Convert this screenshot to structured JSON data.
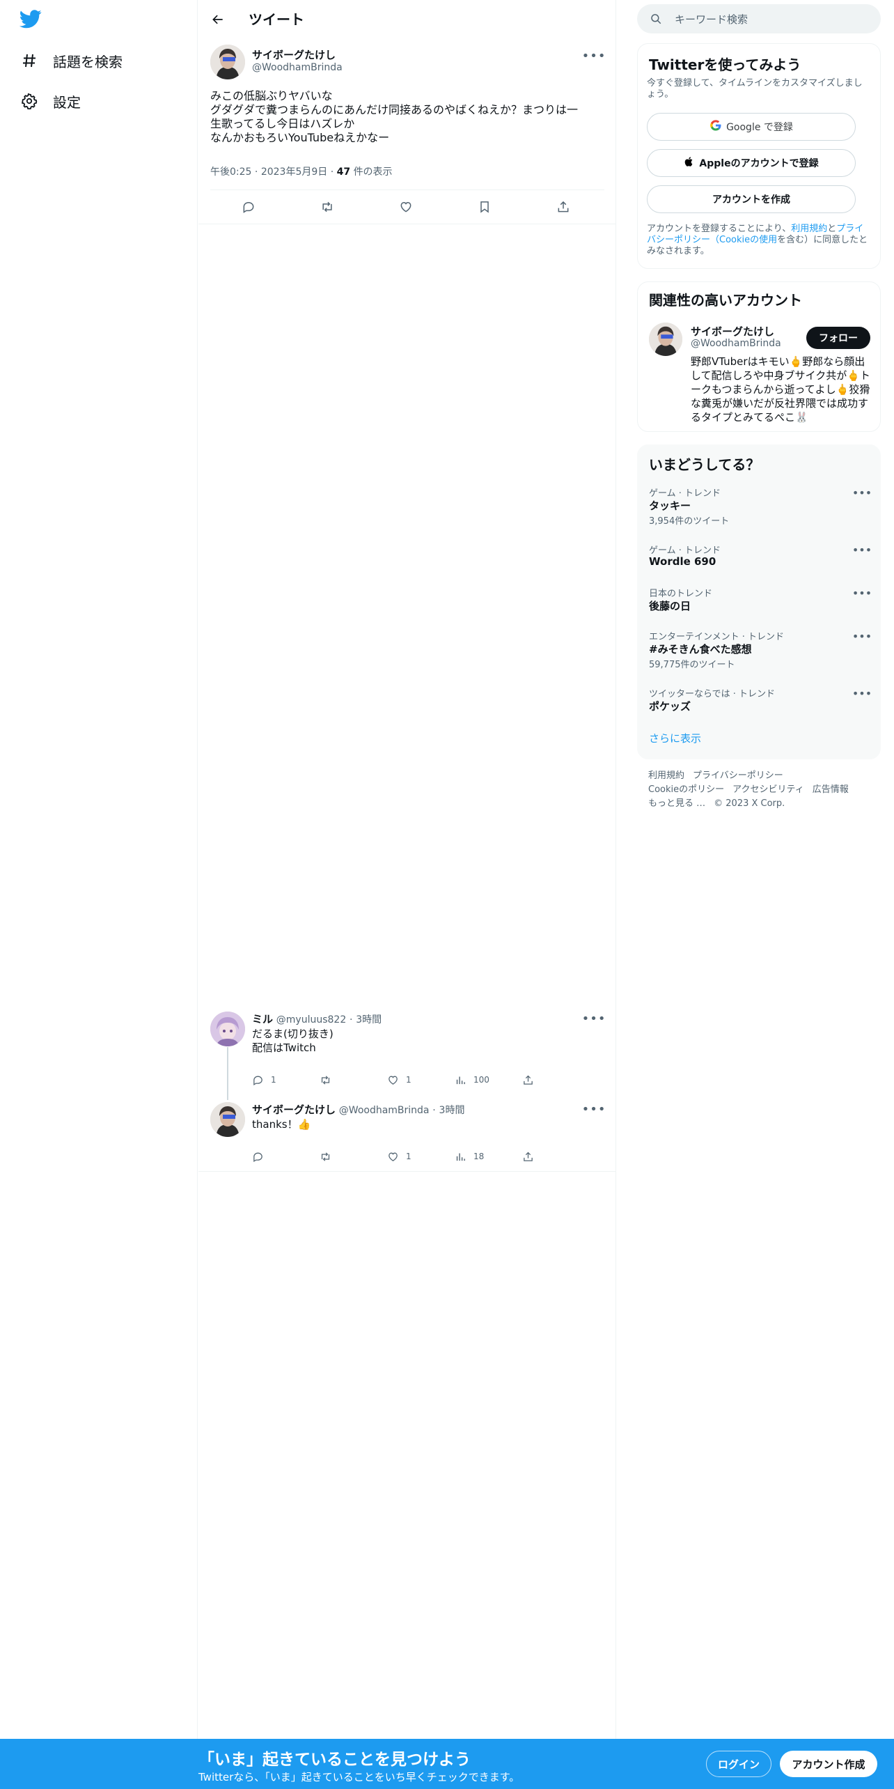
{
  "colors": {
    "brand": "#1d9bf0",
    "text": "#0f1419",
    "muted": "#536471"
  },
  "nav": {
    "logo_icon": "twitter-bird-icon",
    "items": [
      {
        "icon": "hashtag-icon",
        "label": "話題を検索"
      },
      {
        "icon": "gear-icon",
        "label": "設定"
      }
    ]
  },
  "header": {
    "title": "ツイート"
  },
  "main_tweet": {
    "author_name": "サイボーグたけし",
    "author_handle": "@WoodhamBrinda",
    "text_lines": [
      "みこの低脳ぶりヤバいな",
      "グダグダで糞つまらんのにあんだけ同接あるのやばくねえか？まつりは一",
      "生歌ってるし今日はハズレか",
      "なんかおもろいYouTubeねえかなー"
    ],
    "time": "午後0:25",
    "date": "2023年5月9日",
    "views_count": "47",
    "views_label": "件の表示",
    "dot": "·"
  },
  "replies": [
    {
      "author_name": "ミル",
      "author_handle": "@myuluus822",
      "time": "3時間",
      "text_lines": [
        "だるま(切り抜き)",
        "配信はTwitch"
      ],
      "reply_count": "1",
      "retweet_count": "",
      "like_count": "1",
      "view_count": "100"
    },
    {
      "author_name": "サイボーグたけし",
      "author_handle": "@WoodhamBrinda",
      "time": "3時間",
      "text_lines": [
        "thanks！👍"
      ],
      "reply_count": "",
      "retweet_count": "",
      "like_count": "1",
      "view_count": "18"
    }
  ],
  "search": {
    "placeholder": "キーワード検索"
  },
  "signup_panel": {
    "title": "Twitterを使ってみよう",
    "subtitle": "今すぐ登録して、タイムラインをカスタマイズしましょう。",
    "google_btn": "Google で登録",
    "apple_btn": "Appleのアカウントで登録",
    "create_btn": "アカウントを作成",
    "terms_prefix": "アカウントを登録することにより、",
    "terms_link1": "利用規約",
    "terms_mid": "と",
    "terms_link2": "プライバシーポリシー（Cookieの使用",
    "terms_suffix": "を含む）に同意したとみなされます。"
  },
  "related_panel": {
    "title": "関連性の高いアカウント",
    "name": "サイボーグたけし",
    "handle": "@WoodhamBrinda",
    "follow_btn": "フォロー",
    "bio": "野郎VTuberはキモい🖕野郎なら顔出して配信しろや中身ブサイク共が🖕トークもつまらんから逝ってよし🖕狡猾な糞兎が嫌いだが反社界隈では成功するタイプとみてるぺこ🐰"
  },
  "trends_panel": {
    "title": "いまどうしてる？",
    "trends": [
      {
        "category": "ゲーム · トレンド",
        "name": "タッキー",
        "count": "3,954件のツイート"
      },
      {
        "category": "ゲーム · トレンド",
        "name": "Wordle 690",
        "count": ""
      },
      {
        "category": "日本のトレンド",
        "name": "後藤の日",
        "count": ""
      },
      {
        "category": "エンターテインメント · トレンド",
        "name": "#みそきん食べた感想",
        "count": "59,775件のツイート"
      },
      {
        "category": "ツイッターならでは · トレンド",
        "name": "ポケッズ",
        "count": ""
      }
    ],
    "show_more": "さらに表示"
  },
  "footer": {
    "links": [
      "利用規約",
      "プライバシーポリシー",
      "Cookieのポリシー",
      "アクセシビリティ",
      "広告情報",
      "もっと見る …",
      "© 2023 X Corp."
    ]
  },
  "bottom_bar": {
    "title": "「いま」起きていることを見つけよう",
    "subtitle": "Twitterなら、「いま」起きていることをいち早くチェックできます。",
    "login": "ログイン",
    "signup": "アカウント作成"
  }
}
